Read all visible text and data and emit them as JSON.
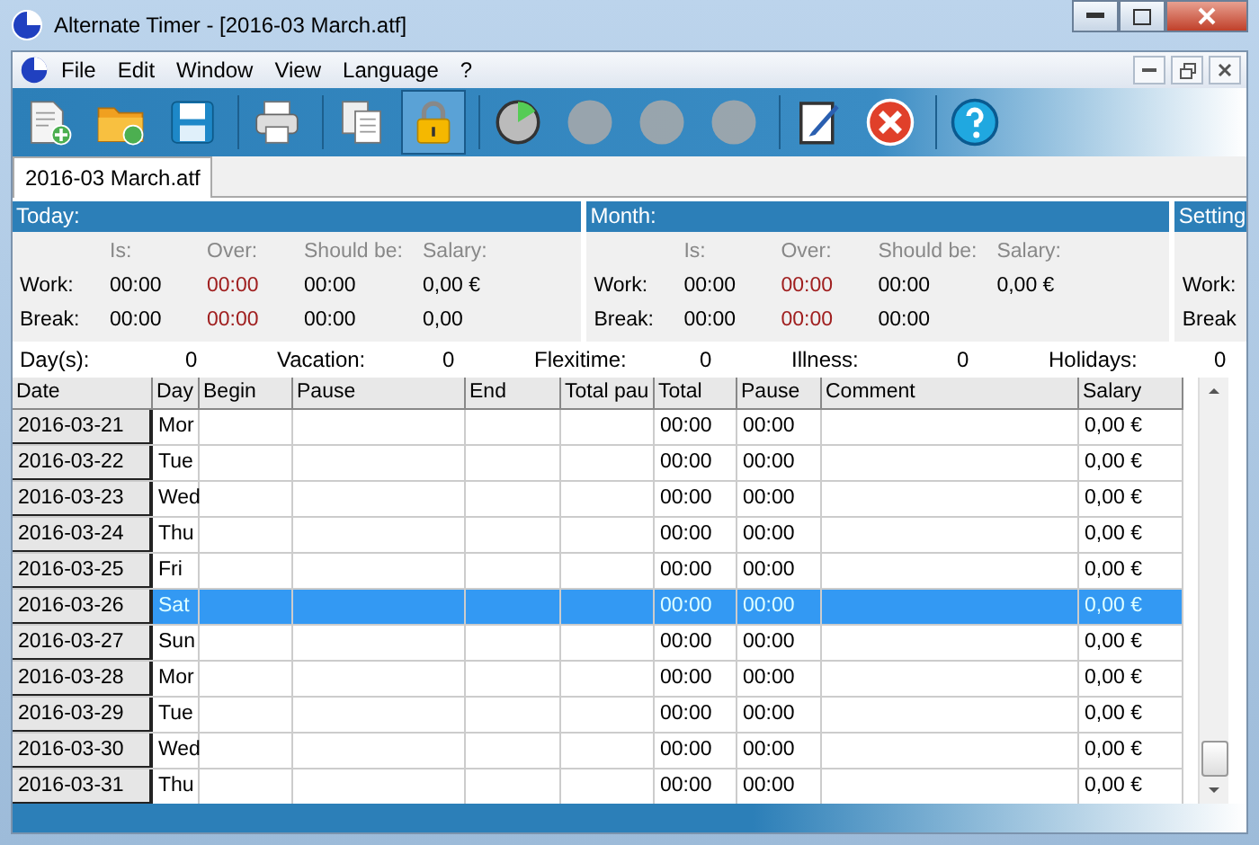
{
  "window": {
    "title": "Alternate Timer - [2016-03 March.atf]"
  },
  "menu": [
    "File",
    "Edit",
    "Window",
    "View",
    "Language",
    "?"
  ],
  "toolbar": [
    {
      "pressed": false,
      "disabled": false
    },
    {
      "pressed": false,
      "disabled": false
    },
    {
      "pressed": false,
      "disabled": false
    },
    {
      "pressed": false,
      "disabled": false
    },
    {
      "pressed": false,
      "disabled": false
    },
    {
      "pressed": true,
      "disabled": false
    },
    {
      "pressed": false,
      "disabled": false
    },
    {
      "pressed": false,
      "disabled": true
    },
    {
      "pressed": false,
      "disabled": true
    },
    {
      "pressed": false,
      "disabled": true
    },
    {
      "pressed": false,
      "disabled": false
    },
    {
      "pressed": false,
      "disabled": false
    },
    {
      "pressed": false,
      "disabled": false
    }
  ],
  "tabs": [
    {
      "label": "2016-03 March.atf",
      "selected": true
    }
  ],
  "panels": [
    {
      "title": "Today:",
      "columns": [
        "Is:",
        "Over:",
        "Should be:",
        "Salary:"
      ],
      "rows": [
        {
          "label": "Work:",
          "values": [
            "00:00",
            "00:00",
            "00:00",
            "0,00 €"
          ]
        },
        {
          "label": "Break:",
          "values": [
            "00:00",
            "00:00",
            "00:00",
            "0,00"
          ]
        }
      ]
    },
    {
      "title": "Month:",
      "columns": [
        "Is:",
        "Over:",
        "Should be:",
        "Salary:"
      ],
      "rows": [
        {
          "label": "Work:",
          "values": [
            "00:00",
            "00:00",
            "00:00",
            "0,00 €"
          ]
        },
        {
          "label": "Break:",
          "values": [
            "00:00",
            "00:00",
            "00:00"
          ]
        }
      ]
    },
    {
      "title": "Setting",
      "rows": [
        {
          "label": "Work:"
        },
        {
          "label": "Break"
        }
      ]
    }
  ],
  "stats": [
    {
      "label": "Day(s):",
      "value": "0"
    },
    {
      "label": "Vacation:",
      "value": "0"
    },
    {
      "label": "Flexitime:",
      "value": "0"
    },
    {
      "label": "Illness:",
      "value": "0"
    },
    {
      "label": "Holidays:",
      "value": "0"
    }
  ],
  "table": {
    "columns": [
      "Date",
      "Day",
      "Begin",
      "Pause",
      "End",
      "Total pau",
      "Total",
      "Pause",
      "Comment",
      "Salary"
    ],
    "rows": [
      {
        "date": "2016-03-21",
        "day": "Mor",
        "total": "00:00",
        "pause": "00:00",
        "salary": "0,00 €",
        "selected": false
      },
      {
        "date": "2016-03-22",
        "day": "Tue",
        "total": "00:00",
        "pause": "00:00",
        "salary": "0,00 €",
        "selected": false
      },
      {
        "date": "2016-03-23",
        "day": "Wed",
        "total": "00:00",
        "pause": "00:00",
        "salary": "0,00 €",
        "selected": false
      },
      {
        "date": "2016-03-24",
        "day": "Thu",
        "total": "00:00",
        "pause": "00:00",
        "salary": "0,00 €",
        "selected": false
      },
      {
        "date": "2016-03-25",
        "day": "Fri",
        "total": "00:00",
        "pause": "00:00",
        "salary": "0,00 €",
        "selected": false
      },
      {
        "date": "2016-03-26",
        "day": "Sat",
        "total": "00:00",
        "pause": "00:00",
        "salary": "0,00 €",
        "selected": true
      },
      {
        "date": "2016-03-27",
        "day": "Sun",
        "total": "00:00",
        "pause": "00:00",
        "salary": "0,00 €",
        "selected": false
      },
      {
        "date": "2016-03-28",
        "day": "Mor",
        "total": "00:00",
        "pause": "00:00",
        "salary": "0,00 €",
        "selected": false
      },
      {
        "date": "2016-03-29",
        "day": "Tue",
        "total": "00:00",
        "pause": "00:00",
        "salary": "0,00 €",
        "selected": false
      },
      {
        "date": "2016-03-30",
        "day": "Wed",
        "total": "00:00",
        "pause": "00:00",
        "salary": "0,00 €",
        "selected": false
      },
      {
        "date": "2016-03-31",
        "day": "Thu",
        "total": "00:00",
        "pause": "00:00",
        "salary": "0,00 €",
        "selected": false
      }
    ]
  }
}
